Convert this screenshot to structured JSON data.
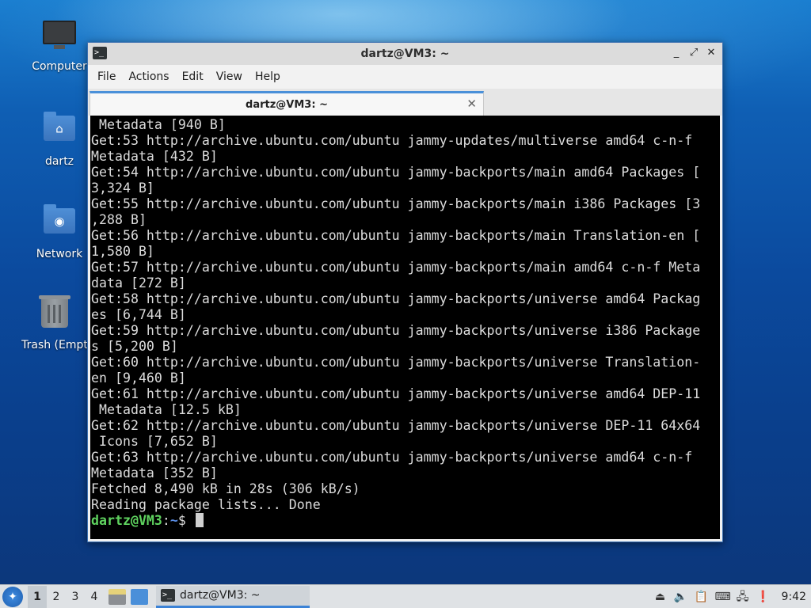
{
  "desktop": {
    "icons": [
      {
        "label": "Computer",
        "icon": "computer-icon"
      },
      {
        "label": "dartz",
        "icon": "home-folder-icon"
      },
      {
        "label": "Network",
        "icon": "network-folder-icon"
      },
      {
        "label": "Trash (Empt",
        "icon": "trash-icon"
      }
    ]
  },
  "window": {
    "title": "dartz@VM3: ~",
    "controls": {
      "minimize": "_",
      "maximize": "⤢",
      "close": "✕"
    },
    "menu": [
      "File",
      "Actions",
      "Edit",
      "View",
      "Help"
    ],
    "tab": {
      "label": "dartz@VM3: ~",
      "close": "✕"
    }
  },
  "terminal": {
    "lines": [
      " Metadata [940 B]",
      "Get:53 http://archive.ubuntu.com/ubuntu jammy-updates/multiverse amd64 c-n-f",
      "Metadata [432 B]",
      "Get:54 http://archive.ubuntu.com/ubuntu jammy-backports/main amd64 Packages [",
      "3,324 B]",
      "Get:55 http://archive.ubuntu.com/ubuntu jammy-backports/main i386 Packages [3",
      ",288 B]",
      "Get:56 http://archive.ubuntu.com/ubuntu jammy-backports/main Translation-en [",
      "1,580 B]",
      "Get:57 http://archive.ubuntu.com/ubuntu jammy-backports/main amd64 c-n-f Meta",
      "data [272 B]",
      "Get:58 http://archive.ubuntu.com/ubuntu jammy-backports/universe amd64 Packag",
      "es [6,744 B]",
      "Get:59 http://archive.ubuntu.com/ubuntu jammy-backports/universe i386 Package",
      "s [5,200 B]",
      "Get:60 http://archive.ubuntu.com/ubuntu jammy-backports/universe Translation-",
      "en [9,460 B]",
      "Get:61 http://archive.ubuntu.com/ubuntu jammy-backports/universe amd64 DEP-11",
      " Metadata [12.5 kB]",
      "Get:62 http://archive.ubuntu.com/ubuntu jammy-backports/universe DEP-11 64x64",
      " Icons [7,652 B]",
      "Get:63 http://archive.ubuntu.com/ubuntu jammy-backports/universe amd64 c-n-f",
      "Metadata [352 B]",
      "Fetched 8,490 kB in 28s (306 kB/s)",
      "Reading package lists... Done"
    ],
    "prompt": {
      "user": "dartz@VM3",
      "sep": ":",
      "path": "~",
      "symbol": "$ "
    }
  },
  "taskbar": {
    "start_icon": "lxqt-start-icon",
    "workspaces": [
      "1",
      "2",
      "3",
      "4"
    ],
    "active_workspace": "1",
    "task_label": "dartz@VM3: ~",
    "clock": "9:42"
  }
}
